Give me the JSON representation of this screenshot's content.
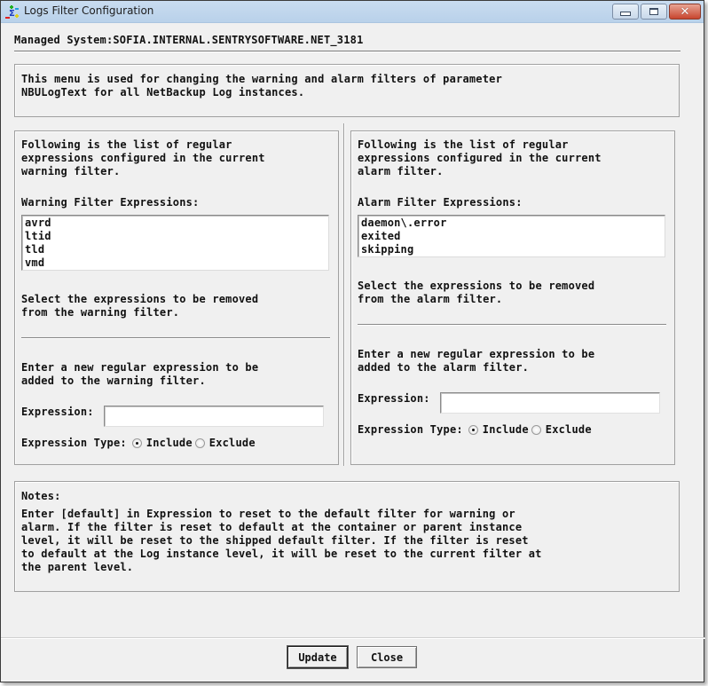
{
  "window": {
    "title": "Logs Filter Configuration",
    "icons": {
      "app": "sigma-app-icon",
      "minimize": "minimize-icon",
      "maximize": "maximize-icon",
      "close": "close-icon"
    },
    "close_glyph": "✕"
  },
  "header": {
    "managed_system": "Managed System:SOFIA.INTERNAL.SENTRYSOFTWARE.NET_3181"
  },
  "intro": {
    "text": "This menu is used for changing the warning and alarm filters of parameter\nNBULogText for all NetBackup Log instances."
  },
  "warning_panel": {
    "description": "Following is the list of regular\nexpressions configured in the current\nwarning filter.",
    "list_label": "Warning Filter Expressions:",
    "expressions": [
      "avrd",
      "ltid",
      "tld",
      "vmd"
    ],
    "remove_hint": "Select the expressions to be removed\nfrom the warning filter.",
    "add_hint": "Enter a new regular expression to be\nadded to the warning filter.",
    "expression_label": "Expression:",
    "expression_value": "",
    "type_label": "Expression Type:",
    "type_options": [
      "Include",
      "Exclude"
    ],
    "type_selected": "Include"
  },
  "alarm_panel": {
    "description": "Following is the list of regular\nexpressions configured in the current\nalarm filter.",
    "list_label": "Alarm Filter Expressions:",
    "expressions": [
      "daemon\\.error",
      "exited",
      "skipping"
    ],
    "remove_hint": "Select the expressions to be removed\nfrom the alarm filter.",
    "add_hint": "Enter a new regular expression to be\nadded to the alarm filter.",
    "expression_label": "Expression:",
    "expression_value": "",
    "type_label": "Expression Type:",
    "type_options": [
      "Include",
      "Exclude"
    ],
    "type_selected": "Include"
  },
  "notes": {
    "title": "Notes:",
    "text": "Enter [default] in Expression to reset to the default filter for warning or\nalarm. If the filter is reset to default at the container or parent instance\nlevel, it will be reset to the shipped default filter. If the filter is reset\nto default at the Log instance level, it will be reset to the current filter at\nthe parent level."
  },
  "buttons": {
    "update": "Update",
    "close": "Close"
  }
}
